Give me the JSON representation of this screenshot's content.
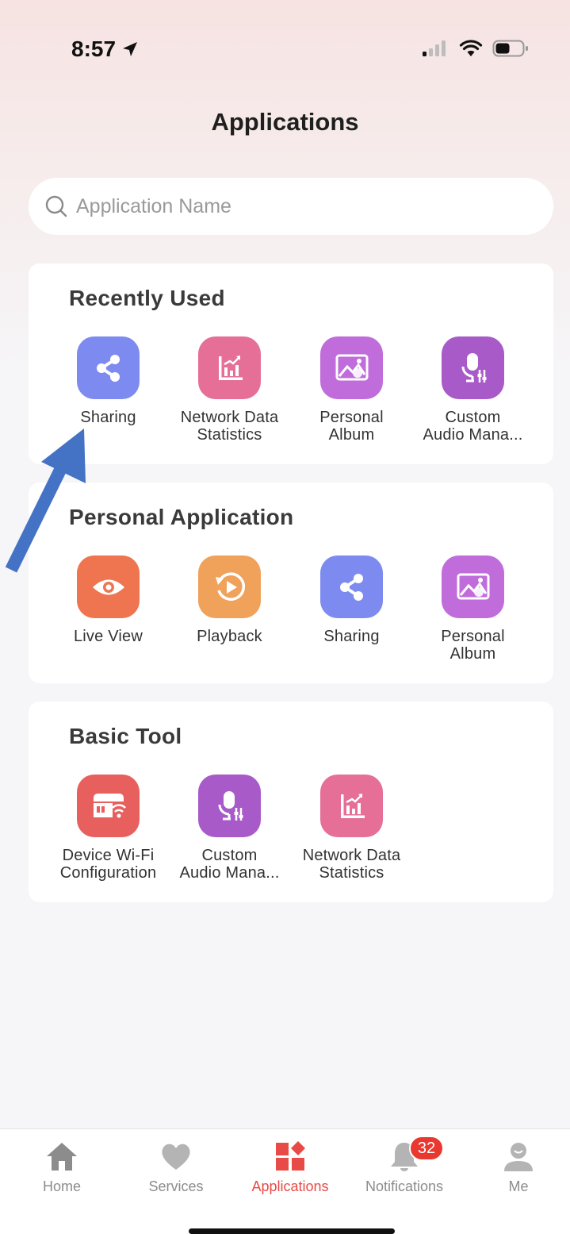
{
  "status_bar": {
    "time": "8:57"
  },
  "header": {
    "title": "Applications"
  },
  "search": {
    "placeholder": "Application Name"
  },
  "sections": [
    {
      "title": "Recently Used",
      "apps": [
        {
          "label": "Sharing",
          "icon": "share-icon",
          "color": "#7d8bf0"
        },
        {
          "label": "Network Data\nStatistics",
          "icon": "chart-icon",
          "color": "#e56f97"
        },
        {
          "label": "Personal\nAlbum",
          "icon": "album-icon",
          "color": "#c06cdb"
        },
        {
          "label": "Custom\nAudio Mana...",
          "icon": "audio-icon",
          "color": "#a95ac9"
        }
      ]
    },
    {
      "title": "Personal Application",
      "apps": [
        {
          "label": "Live View",
          "icon": "eye-icon",
          "color": "#ee7550"
        },
        {
          "label": "Playback",
          "icon": "playback-icon",
          "color": "#f0a15a"
        },
        {
          "label": "Sharing",
          "icon": "share-icon",
          "color": "#7d8bf0"
        },
        {
          "label": "Personal\nAlbum",
          "icon": "album-icon",
          "color": "#c06cdb"
        }
      ]
    },
    {
      "title": "Basic Tool",
      "apps": [
        {
          "label": "Device Wi-Fi\nConfiguration",
          "icon": "device-wifi-icon",
          "color": "#e8605e"
        },
        {
          "label": "Custom\nAudio Mana...",
          "icon": "audio-icon",
          "color": "#a95ac9"
        },
        {
          "label": "Network Data\nStatistics",
          "icon": "chart-icon",
          "color": "#e56f97"
        }
      ]
    }
  ],
  "tabbar": {
    "tabs": [
      {
        "label": "Home",
        "icon": "home-icon",
        "active": false
      },
      {
        "label": "Services",
        "icon": "heart-icon",
        "active": false
      },
      {
        "label": "Applications",
        "icon": "applications-icon",
        "active": true
      },
      {
        "label": "Notifications",
        "icon": "bell-icon",
        "active": false,
        "badge": "32"
      },
      {
        "label": "Me",
        "icon": "person-icon",
        "active": false
      }
    ]
  },
  "colors": {
    "accent": "#e84b47",
    "annotation_arrow": "#4472c4"
  }
}
